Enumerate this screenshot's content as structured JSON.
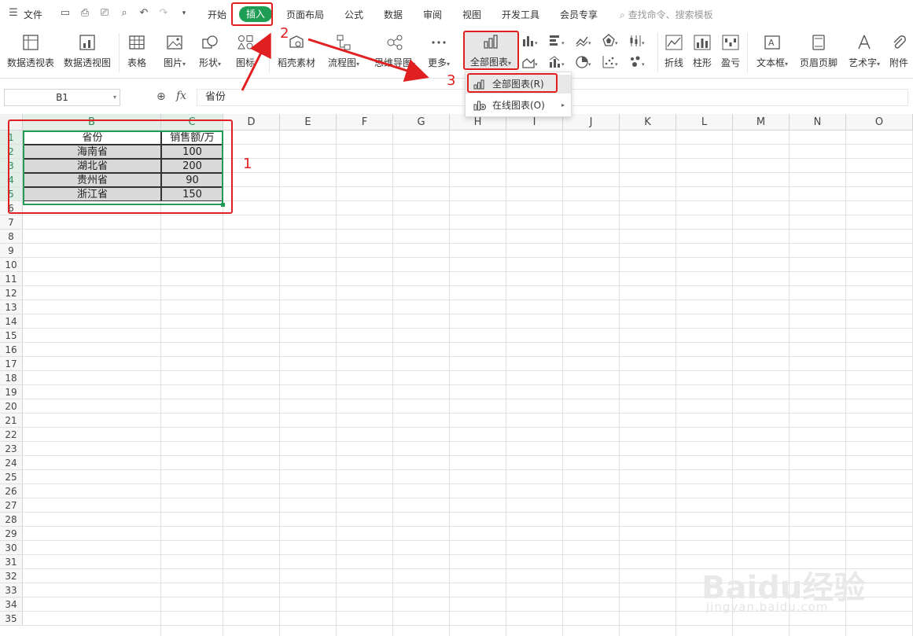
{
  "menubar": {
    "file": "文件",
    "tabs": [
      "开始",
      "插入",
      "页面布局",
      "公式",
      "数据",
      "审阅",
      "视图",
      "开发工具",
      "会员专享"
    ],
    "search_placeholder": "查找命令、搜索模板"
  },
  "ribbon": {
    "pivot_table": "数据透视表",
    "pivot_chart": "数据透视图",
    "table": "表格",
    "picture": "图片",
    "shape": "形状",
    "icon": "图标",
    "docer": "稻壳素材",
    "flowchart": "流程图",
    "mindmap": "思维导图",
    "more": "更多",
    "all_charts": "全部图表",
    "sparkline_line": "折线",
    "sparkline_column": "柱形",
    "sparkline_winloss": "盈亏",
    "textbox": "文本框",
    "header_footer": "页眉页脚",
    "wordart": "艺术字",
    "attachment": "附件"
  },
  "chart_menu": {
    "all_charts": "全部图表(R)",
    "online_charts": "在线图表(O)"
  },
  "formula": {
    "name_box": "B1",
    "fx": "fx",
    "value": "省份"
  },
  "sheet": {
    "columns": [
      "B",
      "C",
      "D",
      "E",
      "F",
      "G",
      "H",
      "I",
      "J",
      "K",
      "L",
      "M",
      "N",
      "O"
    ],
    "rows": [
      "1",
      "2",
      "3",
      "4",
      "5",
      "6",
      "7",
      "8",
      "9",
      "10",
      "11",
      "12",
      "13",
      "14",
      "15",
      "16",
      "17",
      "18",
      "19",
      "20",
      "21",
      "22",
      "23",
      "24",
      "25",
      "26",
      "27",
      "28",
      "29",
      "30",
      "31",
      "32",
      "33",
      "34",
      "35"
    ],
    "table": {
      "headers": [
        "省份",
        "销售额/万"
      ],
      "data": [
        [
          "海南省",
          "100"
        ],
        [
          "湖北省",
          "200"
        ],
        [
          "贵州省",
          "90"
        ],
        [
          "浙江省",
          "150"
        ]
      ]
    }
  },
  "annotations": [
    "1",
    "2",
    "3"
  ],
  "watermark": {
    "logo": "Baidu经验",
    "url": "jingyan.baidu.com"
  },
  "colors": {
    "accent": "#1f9d55",
    "annotation": "#e02020"
  }
}
